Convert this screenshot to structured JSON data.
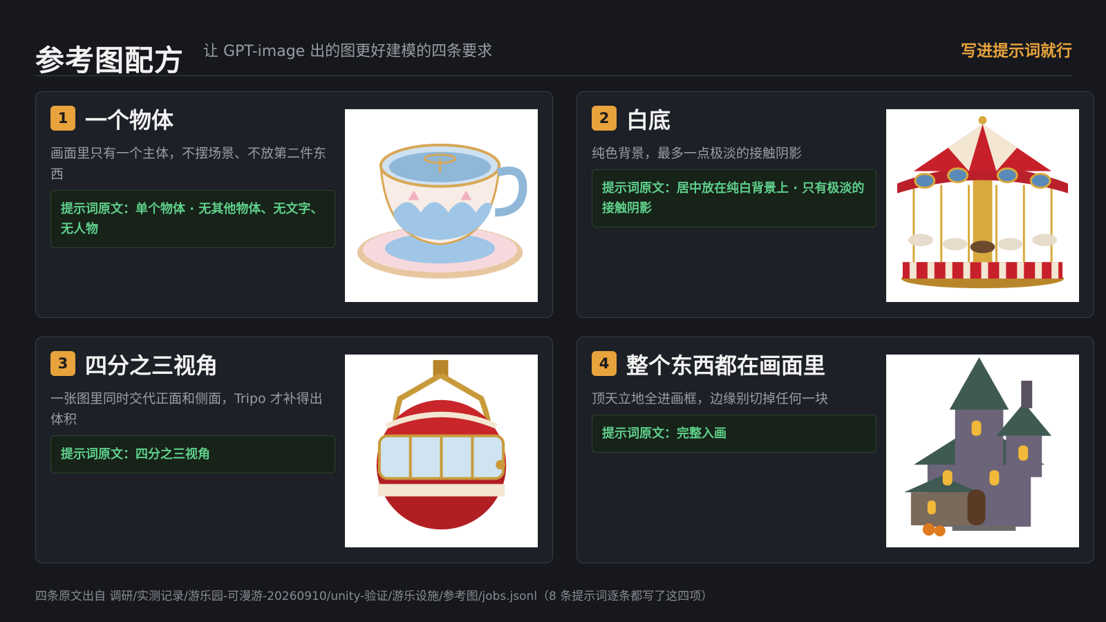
{
  "header": {
    "title": "参考图配方",
    "subtitle": "让 GPT-image 出的图更好建模的四条要求",
    "right_label": "写进提示词就行"
  },
  "cards": [
    {
      "number": "1",
      "title": "一个物体",
      "description": "画面里只有一个主体，不摆场景、不放第二件东西",
      "prompt": "提示词原文：单个物体 · 无其他物体、无文字、无人物"
    },
    {
      "number": "2",
      "title": "白底",
      "description": "纯色背景，最多一点极淡的接触阴影",
      "prompt": "提示词原文：居中放在纯白背景上 · 只有极淡的接触阴影"
    },
    {
      "number": "3",
      "title": "四分之三视角",
      "description": "一张图里同时交代正面和侧面，Tripo 才补得出体积",
      "prompt": "提示词原文：四分之三视角"
    },
    {
      "number": "4",
      "title": "整个东西都在画面里",
      "description": "顶天立地全进画框，边缘别切掉任何一块",
      "prompt": "提示词原文：完整入画"
    }
  ],
  "footer": {
    "text": "四条原文出自 调研/实测记录/游乐园-可漫游-20260910/unity-验证/游乐设施/参考图/jobs.jsonl（8 条提示词逐条都写了这四项）"
  },
  "colors": {
    "accent": "#e8a33c",
    "prompt_text": "#5ecf8a",
    "background": "#16181d"
  }
}
